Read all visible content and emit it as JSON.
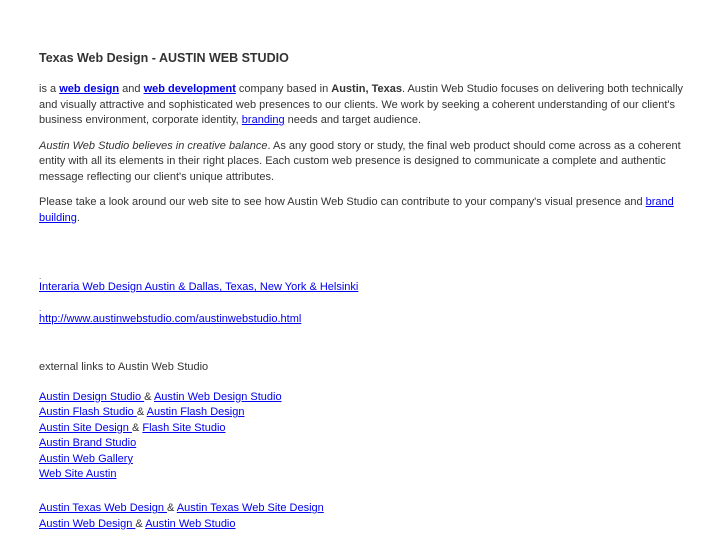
{
  "heading": "Texas Web Design - AUSTIN WEB STUDIO",
  "intro": {
    "pre": "is a ",
    "link_web_design": "web design",
    "and": " and ",
    "link_web_development": "web development",
    "mid1": " company based in ",
    "location_bold": "Austin, Texas",
    "mid2": ". Austin Web Studio focuses on delivering both technically and visually attractive and sophisticated web presences to our clients. We work by seeking a coherent understanding of our client's business environment, corporate identity, ",
    "link_branding": "branding",
    "post": " needs and target audience."
  },
  "belief": {
    "italic": "Austin Web Studio believes in creative balance",
    "rest": ". As any good story or study, the final web product should come across as a coherent entity with all its elements in their right places. Each custom web presence is designed to communicate a complete and authentic message reflecting our client's unique attributes."
  },
  "invite": {
    "text": "Please take a look around our web site to see how Austin Web Studio can contribute to your company's visual presence and ",
    "link_brand_building": "brand building",
    "post": "."
  },
  "dot": ".",
  "interaria_link": "Interaria Web Design Austin & Dallas, Texas, New York & Helsinki ",
  "url_link": "http://www.austinwebstudio.com/austinwebstudio.html",
  "external_label": "external links to Austin Web Studio",
  "amp": " & ",
  "links": {
    "design_studio": "Austin Design Studio ",
    "web_design_studio": "Austin Web Design Studio ",
    "flash_studio": "Austin Flash Studio ",
    "flash_design": "Austin Flash Design ",
    "site_design": "Austin Site Design ",
    "flash_site_studio": "Flash Site Studio ",
    "brand_studio": "Austin Brand Studio ",
    "web_gallery": "Austin Web Gallery ",
    "web_site_austin": "Web Site Austin ",
    "texas_web_design": "Austin Texas Web Design ",
    "texas_web_site_design": "Austin Texas Web Site Design ",
    "web_design": "Austin Web Design ",
    "web_studio": "Austin Web Studio "
  }
}
